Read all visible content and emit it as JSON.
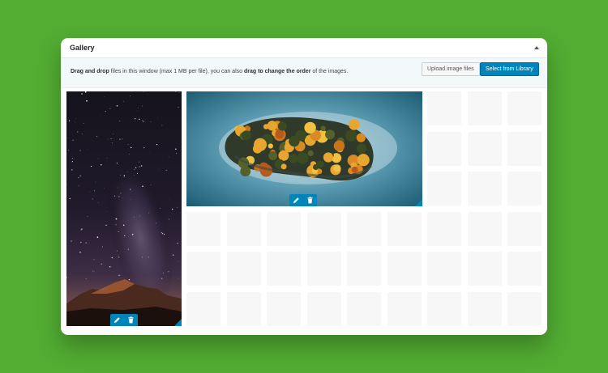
{
  "panel": {
    "title": "Gallery"
  },
  "info": {
    "part1": "Drag and drop",
    "part2": " files in this window (max 1 MB per file), you can also ",
    "part3": "drag to change the order",
    "part4": " of the images."
  },
  "buttons": {
    "upload_label": "Upload image files",
    "library_label": "Select from Library"
  },
  "gallery": {
    "images": [
      {
        "name": "starry-sky-mountain-image"
      },
      {
        "name": "island-in-fog-aerial-image"
      }
    ],
    "icons": {
      "edit": "pencil-icon",
      "delete": "trash-icon",
      "collapse": "chevron-up-icon"
    }
  }
}
